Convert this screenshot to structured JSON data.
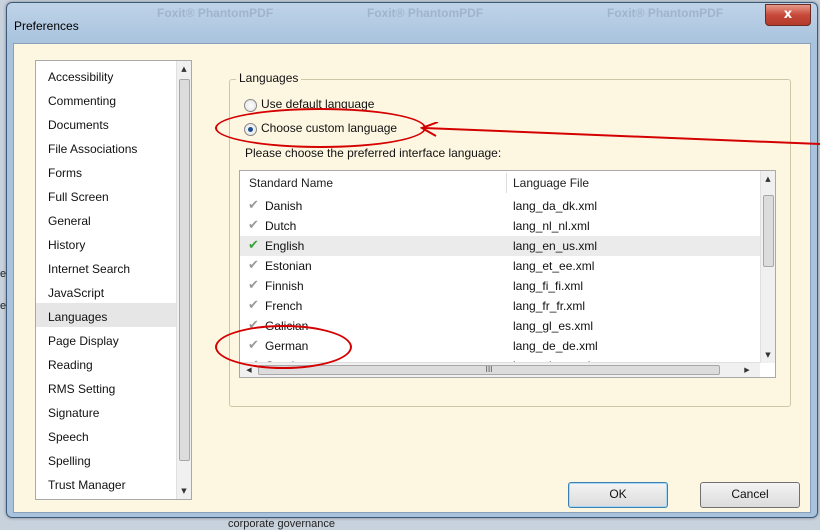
{
  "window": {
    "title": "Preferences",
    "close_label": "x"
  },
  "background": {
    "ghost_texts": [
      "Foxit® PhantomPDF",
      "Foxit® PhantomPDF",
      "Foxit® PhantomPDF"
    ],
    "left_strips": [
      "eu",
      "eu"
    ],
    "bottom_text": "corporate governance"
  },
  "sidebar": {
    "selected": "Languages",
    "items": [
      "Accessibility",
      "Commenting",
      "Documents",
      "File Associations",
      "Forms",
      "Full Screen",
      "General",
      "History",
      "Internet Search",
      "JavaScript",
      "Languages",
      "Page Display",
      "Reading",
      "RMS Setting",
      "Signature",
      "Speech",
      "Spelling",
      "Trust Manager"
    ]
  },
  "languages": {
    "group_label": "Languages",
    "option_default": "Use default language",
    "option_custom": "Choose custom language",
    "prompt": "Please choose the preferred interface language:",
    "columns": [
      "Standard Name",
      "Language File"
    ],
    "rows": [
      {
        "name": "Danish",
        "file": "lang_da_dk.xml",
        "active": false
      },
      {
        "name": "Dutch",
        "file": "lang_nl_nl.xml",
        "active": false
      },
      {
        "name": "English",
        "file": "lang_en_us.xml",
        "active": true
      },
      {
        "name": "Estonian",
        "file": "lang_et_ee.xml",
        "active": false
      },
      {
        "name": "Finnish",
        "file": "lang_fi_fi.xml",
        "active": false
      },
      {
        "name": "French",
        "file": "lang_fr_fr.xml",
        "active": false
      },
      {
        "name": "Galician",
        "file": "lang_gl_es.xml",
        "active": false
      },
      {
        "name": "German",
        "file": "lang_de_de.xml",
        "active": false
      },
      {
        "name": "Greek",
        "file": "lang_el_gr.xml",
        "active": false
      }
    ],
    "hscroll_grip": "III"
  },
  "buttons": {
    "ok": "OK",
    "cancel": "Cancel"
  },
  "colors": {
    "annotation": "#d40000",
    "check_active": "#3aa13a",
    "check_inactive": "#999999"
  }
}
